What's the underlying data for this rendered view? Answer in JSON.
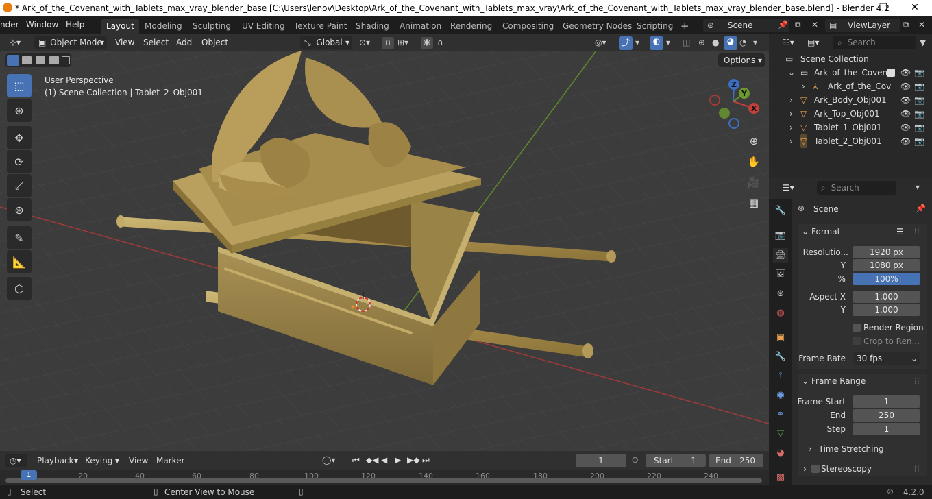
{
  "window": {
    "title": "* Ark_of_the_Covenant_with_Tablets_max_vray_blender_base [C:\\Users\\lenov\\Desktop\\Ark_of_the_Covenant_with_Tablets_max_vray\\Ark_of_the_Covenant_with_Tablets_max_vray_blender_base.blend] - Blender 4.2",
    "minimize": "—",
    "maximize": "❐",
    "close": "✕"
  },
  "menubar": {
    "items": [
      "nder",
      "Window",
      "Help"
    ],
    "workspaces": [
      "Layout",
      "Modeling",
      "Sculpting",
      "UV Editing",
      "Texture Paint",
      "Shading",
      "Animation",
      "Rendering",
      "Compositing",
      "Geometry Nodes",
      "Scripting"
    ],
    "active_workspace": "Layout",
    "add_tab": "+",
    "scene": "Scene",
    "view_layer": "ViewLayer"
  },
  "viewport_header": {
    "mode": "Object Mode",
    "menus": [
      "View",
      "Select",
      "Add",
      "Object"
    ],
    "transform_orientation": "Global",
    "options": "Options"
  },
  "viewport": {
    "perspective": "User Perspective",
    "collection_info": "(1) Scene Collection | Tablet_2_Obj001",
    "gizmo_axes": [
      "X",
      "Y",
      "Z"
    ]
  },
  "outliner": {
    "search_placeholder": "Search",
    "root": "Scene Collection",
    "rows": [
      {
        "label": "Ark_of_the_Covena",
        "icon": "collection-icon"
      },
      {
        "label": "Ark_of_the_Cov",
        "icon": "empty-icon"
      },
      {
        "label": "Ark_Body_Obj001",
        "icon": "mesh-icon"
      },
      {
        "label": "Ark_Top_Obj001",
        "icon": "mesh-icon"
      },
      {
        "label": "Tablet_1_Obj001",
        "icon": "mesh-icon"
      },
      {
        "label": "Tablet_2_Obj001",
        "icon": "mesh-icon"
      }
    ]
  },
  "properties": {
    "search_placeholder": "Search",
    "context": "Scene",
    "format": {
      "title": "Format",
      "resolution_label": "Resolutio...",
      "res_x": "1920 px",
      "y_label": "Y",
      "res_y": "1080 px",
      "pct_label": "%",
      "res_pct": "100%",
      "res_pct_value": 1.0,
      "aspect_label": "Aspect X",
      "aspect_x": "1.000",
      "aspect_y_label": "Y",
      "aspect_y": "1.000",
      "render_region": "Render Region",
      "crop": "Crop to Ren...",
      "frame_rate_label": "Frame Rate",
      "frame_rate": "30 fps"
    },
    "frame_range": {
      "title": "Frame Range",
      "start_label": "Frame Start",
      "start": "1",
      "end_label": "End",
      "end": "250",
      "step_label": "Step",
      "step": "1"
    },
    "time_stretching": "Time Stretching",
    "stereoscopy": "Stereoscopy"
  },
  "timeline": {
    "menus": [
      "Playback",
      "Keying",
      "View",
      "Marker"
    ],
    "current_frame": "1",
    "start_label": "Start",
    "start": "1",
    "end_label": "End",
    "end": "250",
    "ticks": [
      "20",
      "40",
      "60",
      "80",
      "100",
      "120",
      "140",
      "160",
      "180",
      "200",
      "220",
      "240"
    ],
    "playhead": "1"
  },
  "statusbar": {
    "select": "Select",
    "center_view": "Center View to Mouse",
    "version": "4.2.0"
  },
  "colors": {
    "accent": "#4772b3",
    "axis_x": "#c0403c",
    "axis_y": "#6a9a2e",
    "axis_z": "#3b6fc4",
    "gold": "#b59a55"
  }
}
